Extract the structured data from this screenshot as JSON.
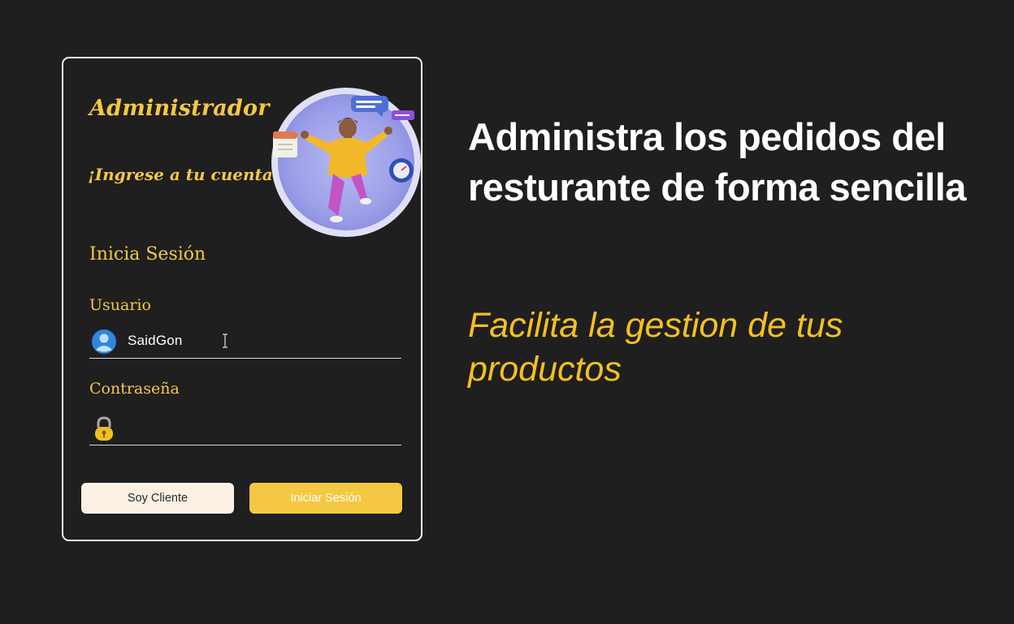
{
  "login_card": {
    "title": "Administrador",
    "subtitle": "¡Ingrese a tu cuenta!",
    "section_title": "Inicia Sesión",
    "username": {
      "label": "Usuario",
      "value": "SaidGon",
      "icon": "user-avatar-icon"
    },
    "password": {
      "label": "Contraseña",
      "value": "",
      "icon": "padlock-icon"
    },
    "buttons": {
      "client_label": "Soy Cliente",
      "login_label": "Iniciar Sesión"
    },
    "illustration": "person-floating-illustration"
  },
  "hero": {
    "headline": "Administra los pedidos del resturante de forma sencilla",
    "tagline": "Facilita la gestion de tus productos"
  },
  "colors": {
    "background": "#1f1f20",
    "accent": "#f4c842",
    "card_border": "#f2f2f2",
    "client_button": "#fcf1e4"
  }
}
